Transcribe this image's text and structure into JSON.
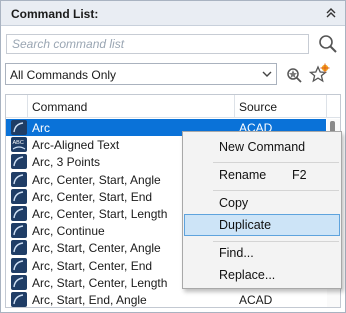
{
  "panel": {
    "title": "Command List:",
    "collapse_icon": "double-chevron-up-icon"
  },
  "search": {
    "placeholder": "Search command list",
    "value": "",
    "icon": "search-icon"
  },
  "filter": {
    "selected": "All Commands Only",
    "find_icon": "find-command-icon",
    "new_icon": "new-command-star-icon"
  },
  "list": {
    "columns": [
      "Command",
      "Source"
    ],
    "rows": [
      {
        "name": "Arc",
        "source": "ACAD",
        "selected": true
      },
      {
        "name": "Arc-Aligned Text",
        "source": ""
      },
      {
        "name": "Arc, 3 Points",
        "source": ""
      },
      {
        "name": "Arc, Center, Start, Angle",
        "source": ""
      },
      {
        "name": "Arc, Center, Start, End",
        "source": ""
      },
      {
        "name": "Arc, Center, Start, Length",
        "source": ""
      },
      {
        "name": "Arc, Continue",
        "source": ""
      },
      {
        "name": "Arc, Start, Center, Angle",
        "source": ""
      },
      {
        "name": "Arc, Start, Center, End",
        "source": ""
      },
      {
        "name": "Arc, Start, Center, Length",
        "source": ""
      },
      {
        "name": "Arc, Start, End, Angle",
        "source": "ACAD"
      }
    ]
  },
  "context_menu": {
    "items": [
      {
        "label": "New Command",
        "shortcut": ""
      },
      {
        "label": "Rename",
        "shortcut": "F2"
      },
      {
        "label": "Copy",
        "shortcut": ""
      },
      {
        "label": "Duplicate",
        "shortcut": "",
        "hovered": true
      },
      {
        "label": "Find...",
        "shortcut": ""
      },
      {
        "label": "Replace...",
        "shortcut": ""
      }
    ]
  },
  "colors": {
    "selection": "#0a72d8",
    "menu_hover": "#cde4f7",
    "title_bar": "#e9edf3"
  }
}
